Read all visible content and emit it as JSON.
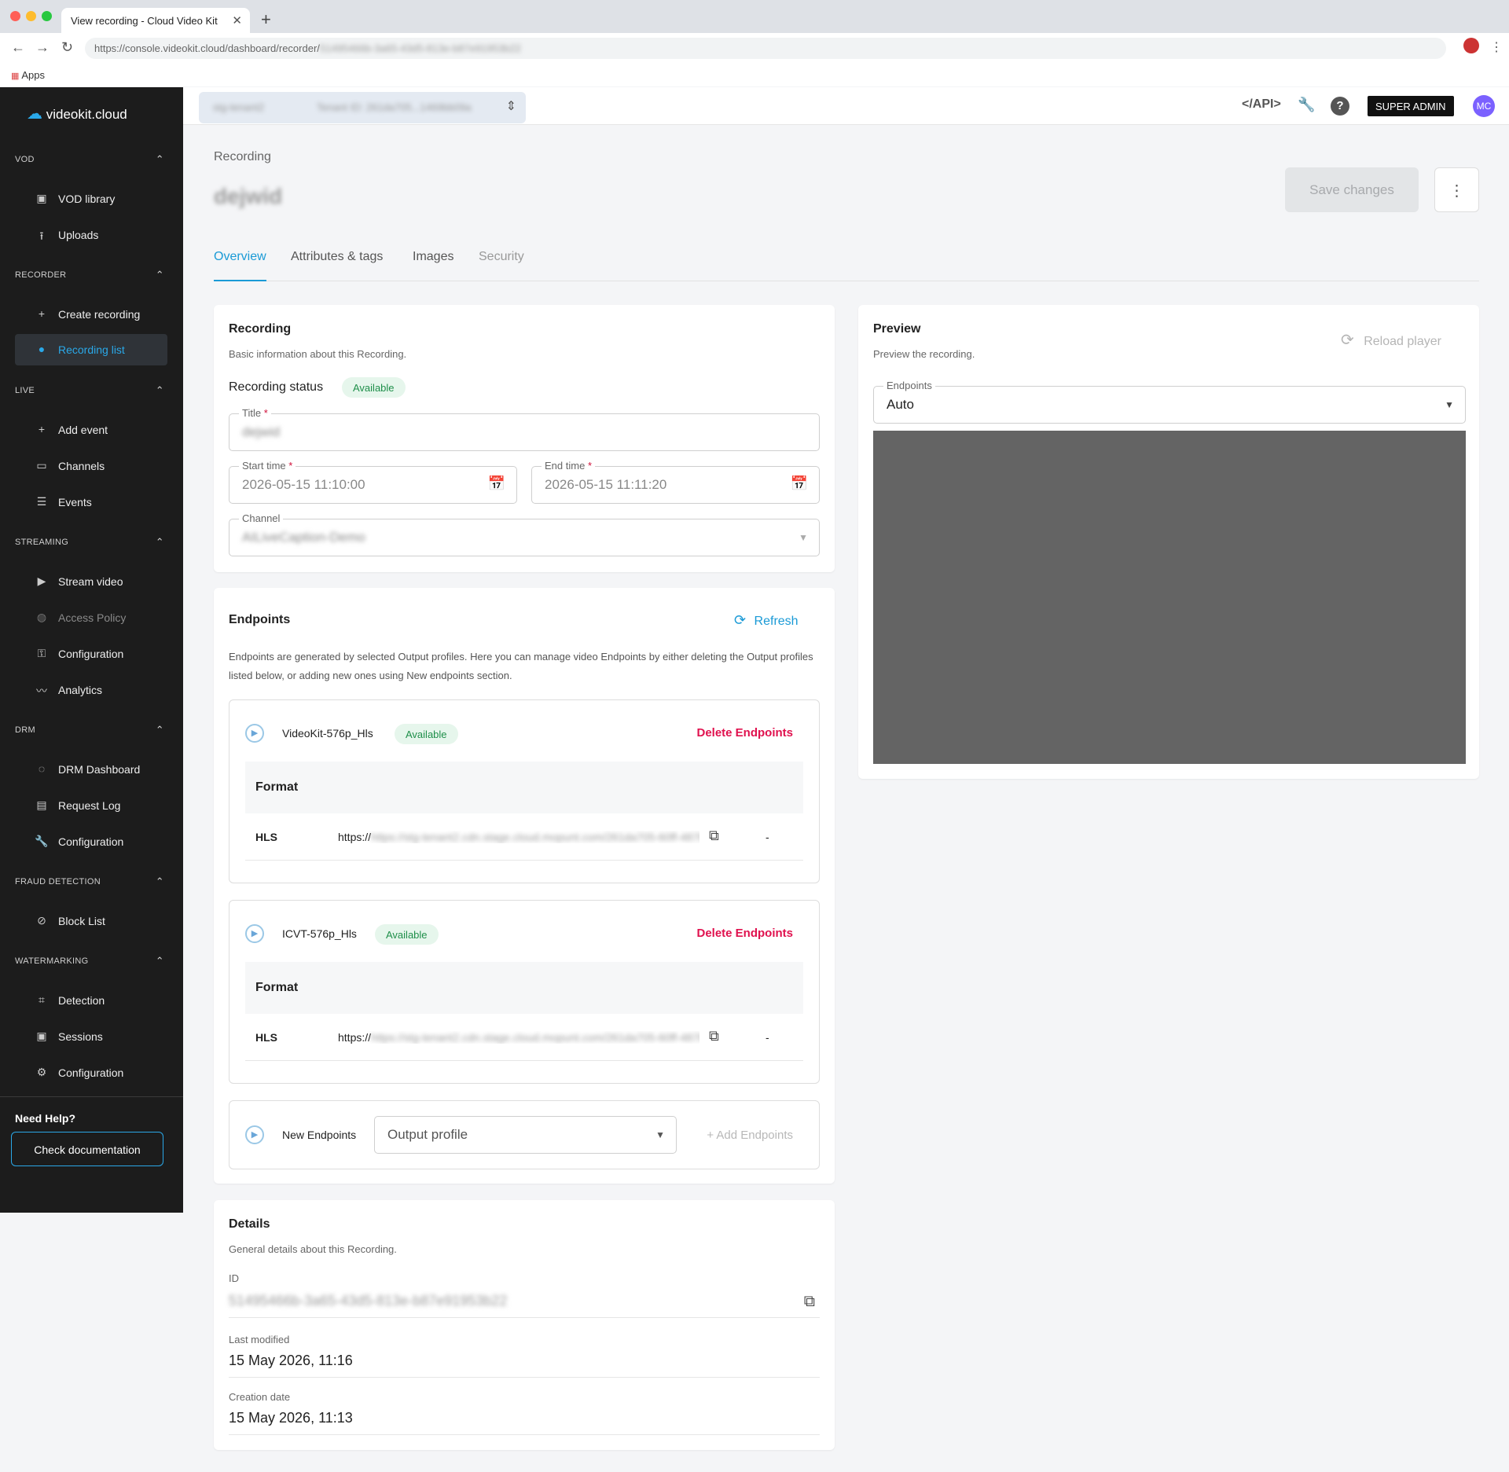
{
  "browser": {
    "tab_title": "View recording - Cloud Video Kit",
    "url_prefix": "https://console.videokit.cloud/dashboard/recorder/",
    "url_suffix": "51495466b-3a65-43d5-813e-b87e91953b22",
    "bookmarks_label": "Apps"
  },
  "sidebar": {
    "logo_text": "videokit.cloud",
    "sections": {
      "vod": "VOD",
      "recorder": "RECORDER",
      "live": "LIVE",
      "streaming": "STREAMING",
      "drm": "DRM",
      "fraud": "FRAUD DETECTION",
      "watermarking": "WATERMARKING"
    },
    "items": {
      "vod_library": "VOD library",
      "uploads": "Uploads",
      "create_recording": "Create recording",
      "recording_list": "Recording list",
      "add_event": "Add event",
      "channels": "Channels",
      "events": "Events",
      "stream_video": "Stream video",
      "access_policy": "Access Policy",
      "stream_configuration": "Configuration",
      "analytics": "Analytics",
      "drm_dashboard": "DRM Dashboard",
      "request_log": "Request Log",
      "drm_configuration": "Configuration",
      "block_list": "Block List",
      "detection": "Detection",
      "sessions": "Sessions",
      "wm_configuration": "Configuration"
    },
    "help_title": "Need Help?",
    "doc_button": "Check documentation"
  },
  "topbar": {
    "tenant_name": "stg-tenant2",
    "tenant_id": "Tenant ID: 261da705...1469bb09a",
    "api_label": "</API>",
    "role_badge": "SUPER ADMIN",
    "avatar_initials": "MC"
  },
  "page": {
    "breadcrumb": "Recording",
    "title": "dejwid",
    "save_button": "Save changes",
    "tabs": {
      "overview": "Overview",
      "attributes": "Attributes & tags",
      "images": "Images",
      "security": "Security"
    }
  },
  "recording_card": {
    "title": "Recording",
    "subtitle": "Basic information about this Recording.",
    "status_label": "Recording status",
    "status_value": "Available",
    "title_label": "Title",
    "title_value": "dejwid",
    "start_label": "Start time",
    "start_value": "2026-05-15 11:10:00",
    "end_label": "End time",
    "end_value": "2026-05-15 11:11:20",
    "channel_label": "Channel",
    "channel_value": "AILiveCaption-Demo",
    "required_mark": "*"
  },
  "endpoints_card": {
    "title": "Endpoints",
    "refresh_label": "Refresh",
    "description": "Endpoints are generated by selected Output profiles. Here you can manage video Endpoints by either deleting the Output profiles listed below, or adding new ones using New endpoints section.",
    "profiles": [
      {
        "name": "VideoKit-576p_Hls",
        "status": "Available",
        "delete_label": "Delete Endpoints",
        "format_header": "Format",
        "protocol": "HLS",
        "url": "https://stg-tenant2.cdn.stage.cloud.mopunt.com/261da705-60ff-4878...",
        "extra": "-"
      },
      {
        "name": "ICVT-576p_Hls",
        "status": "Available",
        "delete_label": "Delete Endpoints",
        "format_header": "Format",
        "protocol": "HLS",
        "url": "https://stg-tenant2.cdn.stage.cloud.mopunt.com/261da705-60ff-4878...",
        "extra": "-"
      }
    ],
    "new_label": "New Endpoints",
    "output_placeholder": "Output profile",
    "add_label": "+ Add Endpoints"
  },
  "details_card": {
    "title": "Details",
    "subtitle": "General details about this Recording.",
    "id_label": "ID",
    "id_value": "51495466b-3a65-43d5-813e-b87e91953b22",
    "modified_label": "Last modified",
    "modified_value": "15 May 2026, 11:16",
    "created_label": "Creation date",
    "created_value": "15 May 2026, 11:13"
  },
  "preview_card": {
    "title": "Preview",
    "subtitle": "Preview the recording.",
    "reload_label": "Reload player",
    "endpoints_label": "Endpoints",
    "endpoints_value": "Auto"
  }
}
